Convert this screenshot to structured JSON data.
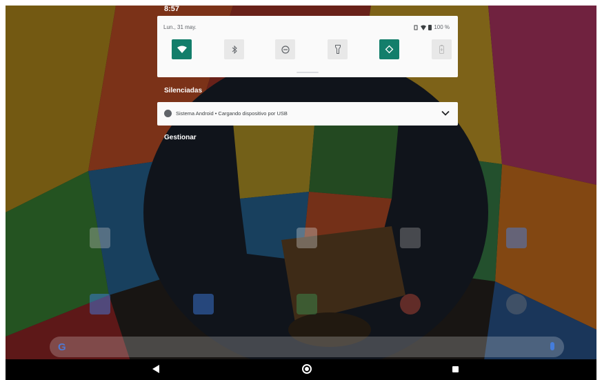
{
  "status_bar": {
    "time": "8:57"
  },
  "quick_settings": {
    "date": "Lun., 31 may.",
    "battery": "100 %",
    "tiles": [
      {
        "icon": "wifi-icon",
        "active": true
      },
      {
        "icon": "bluetooth-icon",
        "active": false
      },
      {
        "icon": "do-not-disturb-icon",
        "active": false
      },
      {
        "icon": "flashlight-icon",
        "active": false
      },
      {
        "icon": "auto-rotate-icon",
        "active": true
      },
      {
        "icon": "battery-saver-icon",
        "active": false
      }
    ]
  },
  "silenced_label": "Silenciadas",
  "notification": {
    "text": "Sistema Android • Cargando dispositivo por USB"
  },
  "manage_label": "Gestionar",
  "colors": {
    "accent": "#137e6b",
    "panel": "#fafafa"
  }
}
